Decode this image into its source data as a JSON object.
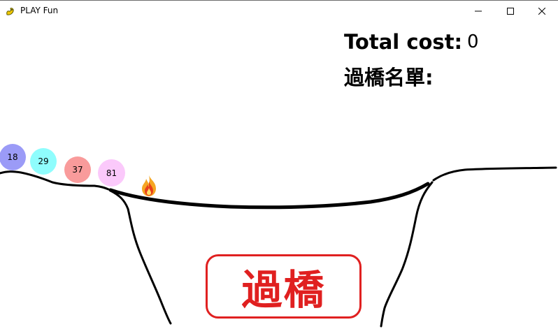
{
  "window": {
    "title": "PLAY Fun",
    "controls": {
      "minimize": "minimize-icon",
      "maximize": "maximize-icon",
      "close": "close-icon"
    }
  },
  "hud": {
    "total_cost_label": "Total cost:",
    "total_cost_value": "0",
    "crossed_list_label": "過橋名單:"
  },
  "people": [
    {
      "label": "18",
      "color": "#9b9bf7"
    },
    {
      "label": "29",
      "color": "#8ffdfd"
    },
    {
      "label": "37",
      "color": "#f99b9b"
    },
    {
      "label": "81",
      "color": "#fbc9fb"
    }
  ],
  "torch": {
    "icon": "fire-icon"
  },
  "cross_button": {
    "label": "過橋",
    "color": "#e02020"
  }
}
